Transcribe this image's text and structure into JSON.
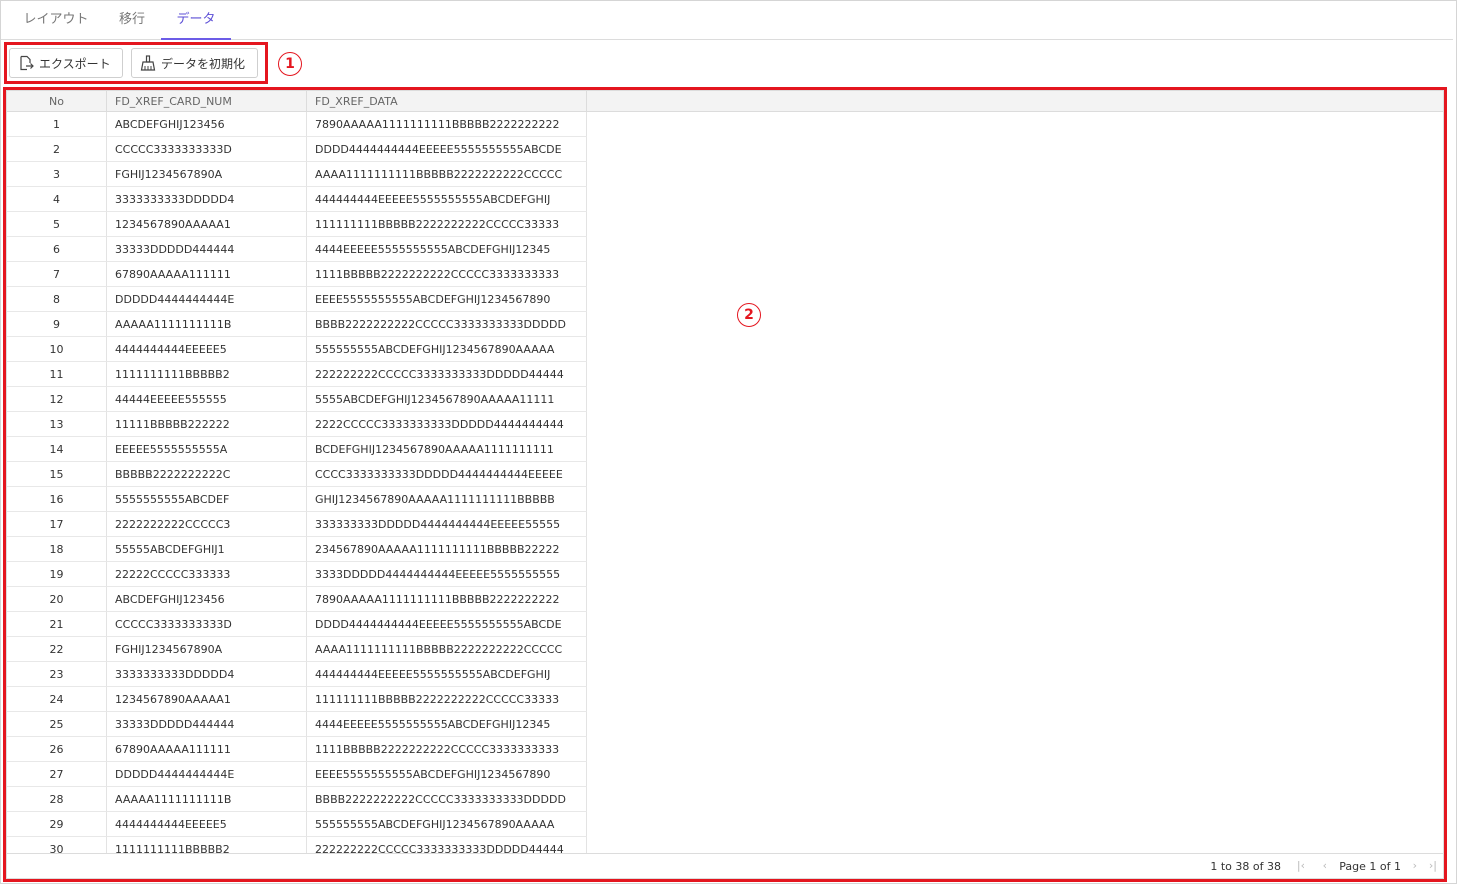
{
  "tabs": [
    {
      "label": "レイアウト"
    },
    {
      "label": "移行"
    },
    {
      "label": "データ"
    }
  ],
  "toolbar": {
    "export_label": "エクスポート",
    "init_label": "データを初期化"
  },
  "markers": {
    "one": "1",
    "two": "2"
  },
  "grid": {
    "columns": [
      "No",
      "FD_XREF_CARD_NUM",
      "FD_XREF_DATA"
    ],
    "rows": [
      [
        "1",
        "ABCDEFGHIJ123456",
        "7890AAAAA1111111111BBBBB2222222222"
      ],
      [
        "2",
        "CCCCC3333333333D",
        "DDDD4444444444EEEEE5555555555ABCDE"
      ],
      [
        "3",
        "FGHIJ1234567890A",
        "AAAA1111111111BBBBB2222222222CCCCC"
      ],
      [
        "4",
        "3333333333DDDDD4",
        "444444444EEEEE5555555555ABCDEFGHIJ"
      ],
      [
        "5",
        "1234567890AAAAA1",
        "111111111BBBBB2222222222CCCCC33333"
      ],
      [
        "6",
        "33333DDDDD444444",
        "4444EEEEE5555555555ABCDEFGHIJ12345"
      ],
      [
        "7",
        "67890AAAAA111111",
        "1111BBBBB2222222222CCCCC3333333333"
      ],
      [
        "8",
        "DDDDD4444444444E",
        "EEEE5555555555ABCDEFGHIJ1234567890"
      ],
      [
        "9",
        "AAAAA1111111111B",
        "BBBB2222222222CCCCC3333333333DDDDD"
      ],
      [
        "10",
        "4444444444EEEEE5",
        "555555555ABCDEFGHIJ1234567890AAAAA"
      ],
      [
        "11",
        "1111111111BBBBB2",
        "222222222CCCCC3333333333DDDDD44444"
      ],
      [
        "12",
        "44444EEEEE555555",
        "5555ABCDEFGHIJ1234567890AAAAA11111"
      ],
      [
        "13",
        "11111BBBBB222222",
        "2222CCCCC3333333333DDDDD4444444444"
      ],
      [
        "14",
        "EEEEE5555555555A",
        "BCDEFGHIJ1234567890AAAAA1111111111"
      ],
      [
        "15",
        "BBBBB2222222222C",
        "CCCC3333333333DDDDD4444444444EEEEE"
      ],
      [
        "16",
        "5555555555ABCDEF",
        "GHIJ1234567890AAAAA1111111111BBBBB"
      ],
      [
        "17",
        "2222222222CCCCC3",
        "333333333DDDDD4444444444EEEEE55555"
      ],
      [
        "18",
        "55555ABCDEFGHIJ1",
        "234567890AAAAA1111111111BBBBB22222"
      ],
      [
        "19",
        "22222CCCCC333333",
        "3333DDDDD4444444444EEEEE5555555555"
      ],
      [
        "20",
        "ABCDEFGHIJ123456",
        "7890AAAAA1111111111BBBBB2222222222"
      ],
      [
        "21",
        "CCCCC3333333333D",
        "DDDD4444444444EEEEE5555555555ABCDE"
      ],
      [
        "22",
        "FGHIJ1234567890A",
        "AAAA1111111111BBBBB2222222222CCCCC"
      ],
      [
        "23",
        "3333333333DDDDD4",
        "444444444EEEEE5555555555ABCDEFGHIJ"
      ],
      [
        "24",
        "1234567890AAAAA1",
        "111111111BBBBB2222222222CCCCC33333"
      ],
      [
        "25",
        "33333DDDDD444444",
        "4444EEEEE5555555555ABCDEFGHIJ12345"
      ],
      [
        "26",
        "67890AAAAA111111",
        "1111BBBBB2222222222CCCCC3333333333"
      ],
      [
        "27",
        "DDDDD4444444444E",
        "EEEE5555555555ABCDEFGHIJ1234567890"
      ],
      [
        "28",
        "AAAAA1111111111B",
        "BBBB2222222222CCCCC3333333333DDDDD"
      ],
      [
        "29",
        "4444444444EEEEE5",
        "555555555ABCDEFGHIJ1234567890AAAAA"
      ],
      [
        "30",
        "1111111111BBBBB2",
        "222222222CCCCC3333333333DDDDD44444"
      ]
    ]
  },
  "footer": {
    "count_text": "1 to 38 of 38",
    "page_text": "Page 1 of 1",
    "icons": [
      "first-page-icon",
      "prev-page-icon",
      "next-page-icon",
      "last-page-icon"
    ]
  },
  "colors": {
    "accent": "#6c5ce7",
    "highlight": "#e4161f"
  }
}
